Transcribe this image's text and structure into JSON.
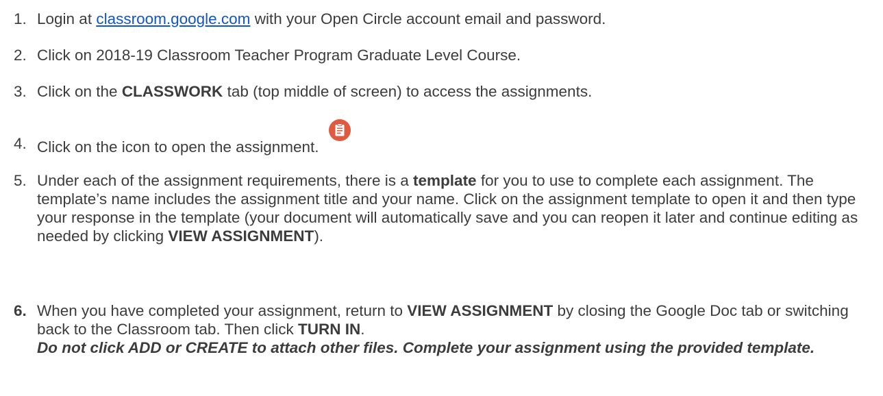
{
  "steps": [
    {
      "num": "1.",
      "pre": "Login at ",
      "link": "classroom.google.com",
      "post": " with your Open Circle account email and password."
    },
    {
      "num": "2.",
      "text": "Click on 2018-19 Classroom Teacher Program Graduate Level Course."
    },
    {
      "num": "3.",
      "pre": "Click on the ",
      "bold": "CLASSWORK",
      "post": " tab (top middle of screen) to access the assignments."
    },
    {
      "num": "4.",
      "text": "Click on the icon to open the assignment.",
      "icon": "assignment-icon",
      "icon_color": "#e05a3f"
    },
    {
      "num": "5.",
      "pre": "Under each of the assignment requirements, there is a ",
      "bold1": "template",
      "mid": " for you to use to complete each assignment. The template’s name includes the assignment title and your name. Click on the assignment template to open it and then type your response in the template (your document will automatically save and you can reopen it later and continue editing as needed by clicking ",
      "bold2": "VIEW ASSIGNMENT",
      "post": ")."
    },
    {
      "num": "6.",
      "pre": "When you have completed your assignment, return to ",
      "bold1": "VIEW ASSIGNMENT",
      "mid": " by closing the Google Doc tab or switching back to the Classroom tab. Then click ",
      "bold2": "TURN IN",
      "post": ".",
      "warning": "Do not click ADD or CREATE to attach other files. Complete your assignment using the provided template."
    }
  ]
}
